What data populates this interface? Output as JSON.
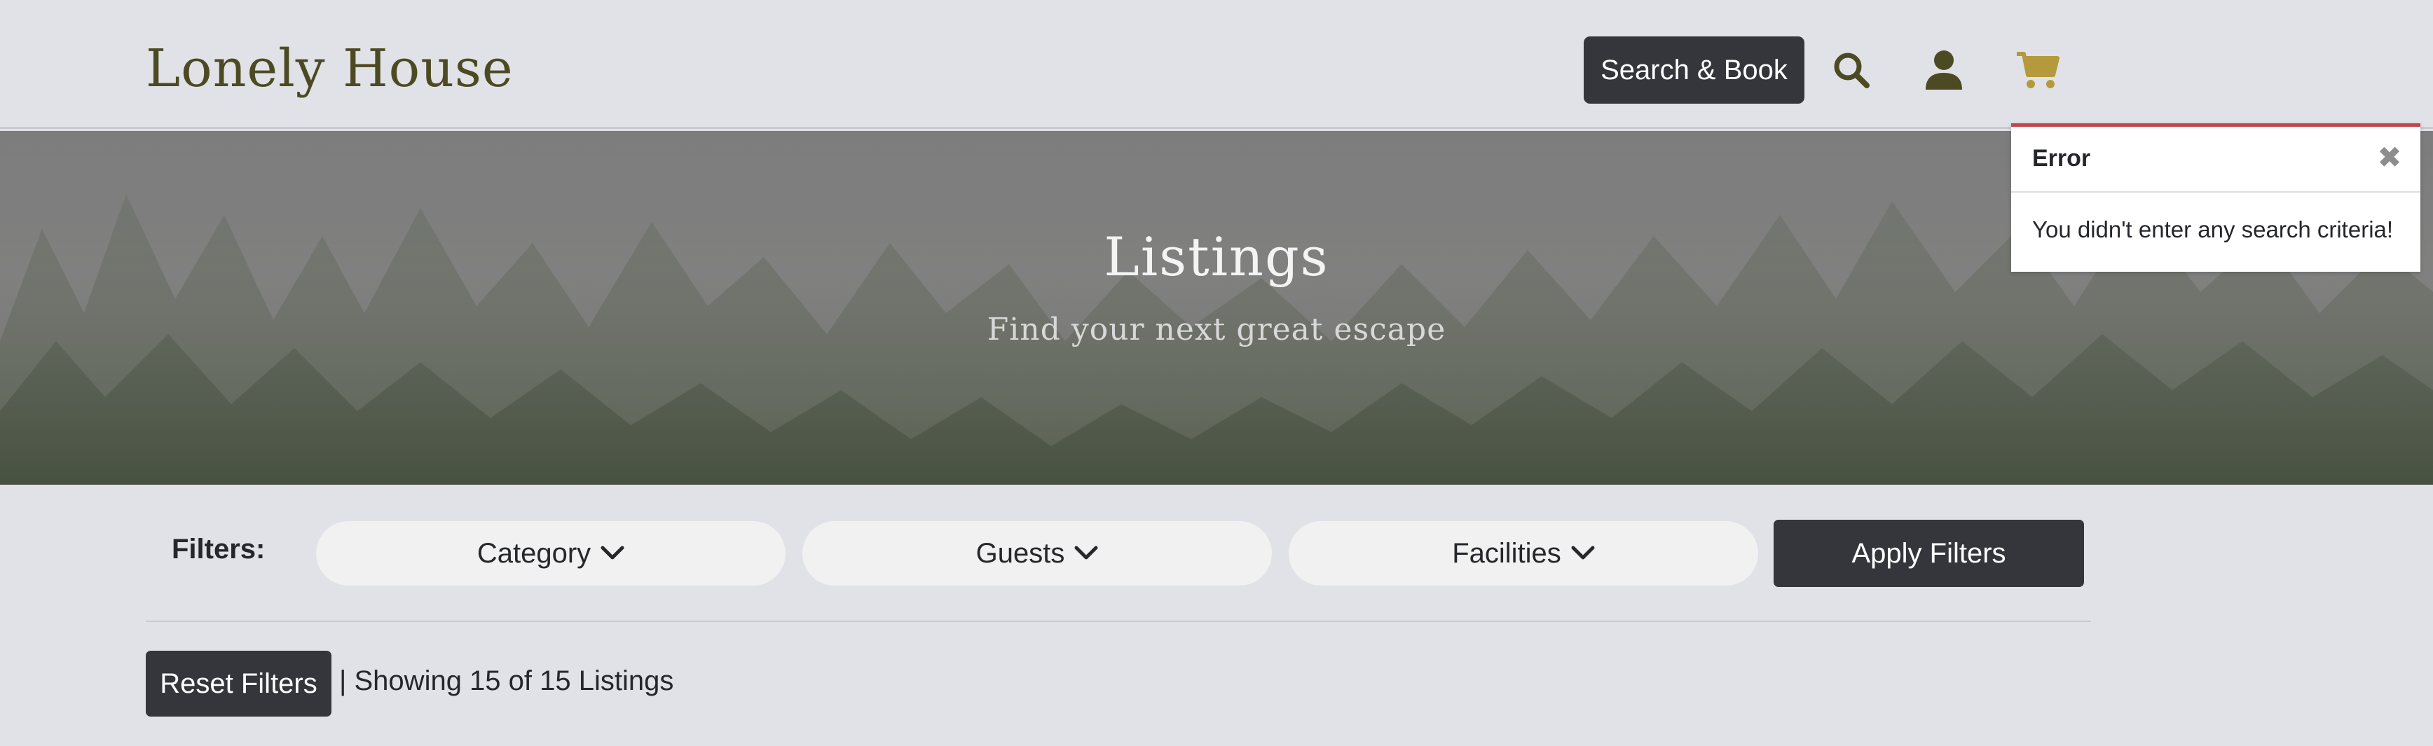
{
  "header": {
    "brand": "Lonely House",
    "search_book_label": "Search & Book",
    "icons": [
      "search-icon",
      "user-icon",
      "cart-icon"
    ],
    "colors": {
      "brand": "#4c4a22",
      "cart": "#b49a3c",
      "button": "#34363b"
    }
  },
  "hero": {
    "title": "Listings",
    "subtitle": "Find your next great escape"
  },
  "toast": {
    "title": "Error",
    "close_glyph": "✖",
    "message": "You didn't enter any search criteria!",
    "accent": "#c6444b"
  },
  "filters": {
    "label": "Filters:",
    "dropdowns": [
      {
        "label": "Category"
      },
      {
        "label": "Guests"
      },
      {
        "label": "Facilities"
      }
    ],
    "apply_label": "Apply Filters"
  },
  "results": {
    "reset_label": "Reset Filters",
    "showing_text": "| Showing 15 of 15 Listings"
  }
}
